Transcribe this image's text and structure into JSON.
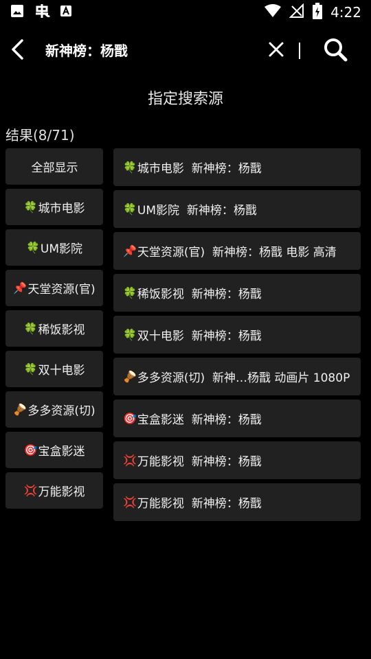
{
  "status_bar": {
    "time": "4:22",
    "left_icons": [
      "image-icon",
      "bug-icon",
      "a-box-icon"
    ],
    "right_icons": [
      "wifi-icon",
      "no-signal-icon",
      "battery-icon"
    ]
  },
  "app_bar": {
    "query": "新神榜：杨戬"
  },
  "section_title": "指定搜索源",
  "result_count": "结果(8/71)",
  "sources": [
    {
      "emoji": "",
      "label": "全部显示"
    },
    {
      "emoji": "🍀",
      "label": "城市电影"
    },
    {
      "emoji": "🍀",
      "label": "UM影院"
    },
    {
      "emoji": "📌",
      "label": "天堂资源(官)"
    },
    {
      "emoji": "🍀",
      "label": "稀饭影视"
    },
    {
      "emoji": "🍀",
      "label": "双十电影"
    },
    {
      "emoji": "🪘",
      "label": "多多资源(切)"
    },
    {
      "emoji": "🎯",
      "label": "宝盒影迷"
    },
    {
      "emoji": "💢",
      "label": "万能影视"
    }
  ],
  "results": [
    {
      "emoji": "🍀",
      "text": "城市电影  新神榜：杨戬"
    },
    {
      "emoji": "🍀",
      "text": "UM影院  新神榜：杨戬"
    },
    {
      "emoji": "📌",
      "text": "天堂资源(官)  新神榜：杨戬 电影 高清"
    },
    {
      "emoji": "🍀",
      "text": "稀饭影视  新神榜：杨戬"
    },
    {
      "emoji": "🍀",
      "text": "双十电影  新神榜：杨戬"
    },
    {
      "emoji": "🪘",
      "text": "多多资源(切)  新神…杨戬 动画片 1080P"
    },
    {
      "emoji": "🎯",
      "text": "宝盒影迷  新神榜：杨戬"
    },
    {
      "emoji": "💢",
      "text": "万能影视  新神榜：杨戬"
    },
    {
      "emoji": "💢",
      "text": "万能影视  新神榜：杨戬"
    }
  ]
}
